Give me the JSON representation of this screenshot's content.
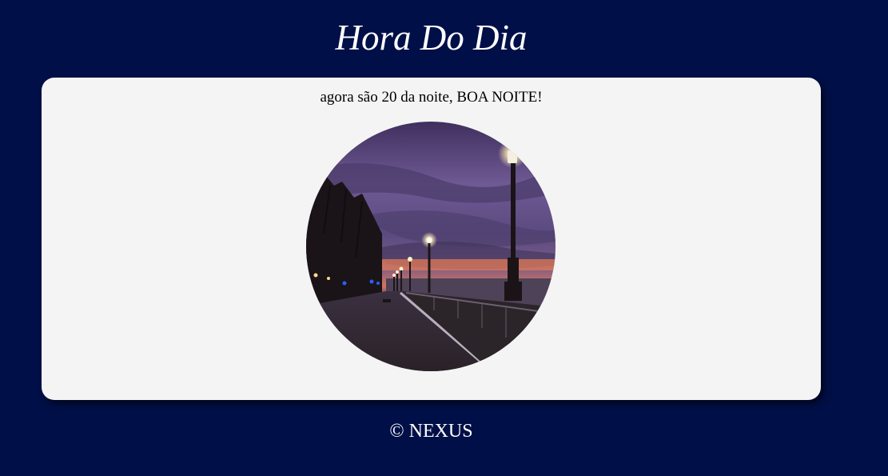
{
  "header": {
    "title": "Hora Do Dia"
  },
  "main": {
    "greeting": "agora são 20 da noite, BOA NOITE!",
    "image": {
      "subject": "night-promenade-with-street-lamps",
      "alt": ""
    }
  },
  "footer": {
    "copyright": "© NEXUS"
  },
  "colors": {
    "page_background": "#000f47",
    "card_background": "#f4f4f4",
    "title_text": "#ffffff",
    "body_text": "#000000"
  }
}
